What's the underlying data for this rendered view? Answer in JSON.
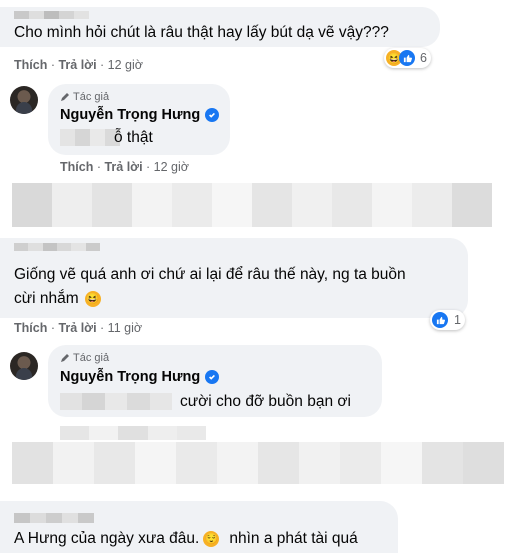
{
  "comments": [
    {
      "text": "Cho mình hỏi chút là râu thật hay lấy bút dạ vẽ vậy???",
      "actions": {
        "like": "Thích",
        "reply": "Trả lời",
        "time": "12 giờ"
      },
      "reactions": {
        "icons": [
          "haha-icon",
          "like-icon"
        ],
        "count": "6"
      },
      "reply": {
        "author_tag": "Tác giả",
        "author": "Nguyễn Trọng Hưng",
        "text": "ỗ thật",
        "actions": {
          "like": "Thích",
          "reply": "Trả lời",
          "time": "12 giờ"
        }
      }
    },
    {
      "text_line1": "Giống vẽ quá anh ơi chứ ai lại để râu thế này, ng ta buồn",
      "text_line2": "cừi nhắm",
      "actions": {
        "like": "Thích",
        "reply": "Trả lời",
        "time": "11 giờ"
      },
      "reactions": {
        "icons": [
          "like-icon"
        ],
        "count": "1"
      },
      "reply": {
        "author_tag": "Tác giả",
        "author": "Nguyễn Trọng Hưng",
        "text": "cười cho đỡ buồn bạn ơi"
      }
    },
    {
      "text": "A Hưng của ngày xưa đâu.",
      "text_tail": "nhìn a phát tài quá"
    }
  ],
  "colors": {
    "bubble": "#f0f2f5",
    "meta": "#65676b",
    "verified": "#1877f2",
    "haha": "#f7b125"
  }
}
